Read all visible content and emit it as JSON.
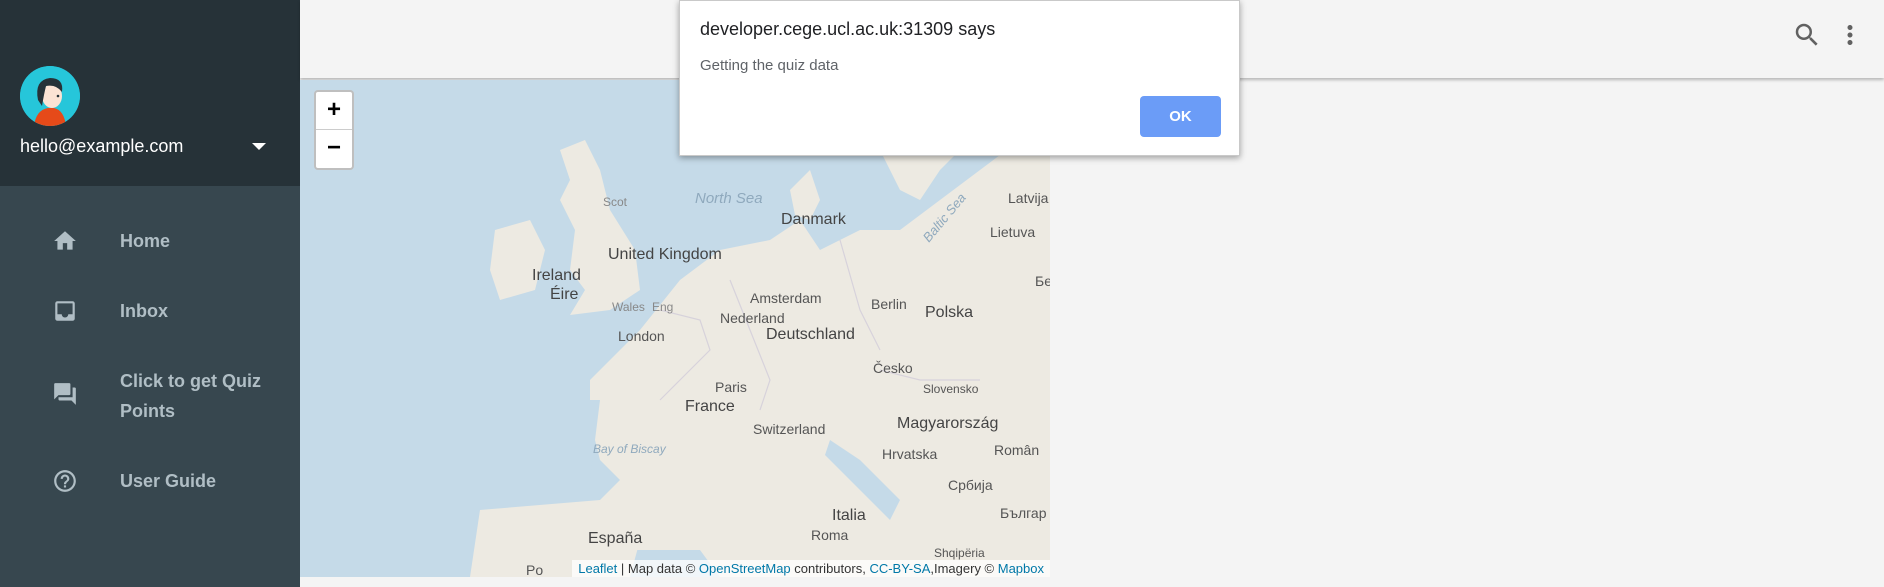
{
  "sidebar": {
    "email": "hello@example.com",
    "items": [
      {
        "label": "Home",
        "icon": "home-icon"
      },
      {
        "label": "Inbox",
        "icon": "inbox-icon"
      },
      {
        "label": "Click to get Quiz Points",
        "icon": "chat-icon"
      },
      {
        "label": "User Guide",
        "icon": "help-icon"
      }
    ]
  },
  "appbar": {
    "icons": [
      "search-icon",
      "more-vert-icon"
    ]
  },
  "map": {
    "labels": {
      "north_sea": "North Sea",
      "danmark": "Danmark",
      "latvija": "Latvija",
      "lietuva": "Lietuva",
      "baltic_sea": "Baltic Sea",
      "united_kingdom": "United Kingdom",
      "ireland": "Ireland",
      "eire": "Éire",
      "scot": "Scot",
      "wales": "Wales",
      "eng": "Eng",
      "london": "London",
      "amsterdam": "Amsterdam",
      "nederland": "Nederland",
      "berlin": "Berlin",
      "deutschland": "Deutschland",
      "polska": "Polska",
      "cesko": "Česko",
      "slovensko": "Slovensko",
      "paris": "Paris",
      "france": "France",
      "switzerland": "Switzerland",
      "magyarorszag": "Magyarország",
      "hrvatska": "Hrvatska",
      "roman": "Român",
      "srbija": "Србија",
      "bay_of_biscay": "Bay of Biscay",
      "italia": "Italia",
      "roma": "Roma",
      "espana": "España",
      "bulgar": "Българ",
      "shqiperia": "Shqipëria",
      "po": "Po",
      "be": "Бе"
    },
    "zoom_in": "+",
    "zoom_out": "−",
    "attribution": {
      "leaflet": "Leaflet",
      "sep1": " | Map data © ",
      "osm": "OpenStreetMap",
      "contrib": " contributors, ",
      "license": "CC-BY-SA",
      "imagery": ",Imagery © ",
      "mapbox": "Mapbox"
    }
  },
  "dialog": {
    "title": "developer.cege.ucl.ac.uk:31309 says",
    "message": "Getting the quiz data",
    "ok_label": "OK"
  },
  "colors": {
    "sidebar_header": "#263238",
    "sidebar_bg": "#37474f",
    "ok_button": "#6b9cf7",
    "avatar_bg": "#26c6da"
  }
}
